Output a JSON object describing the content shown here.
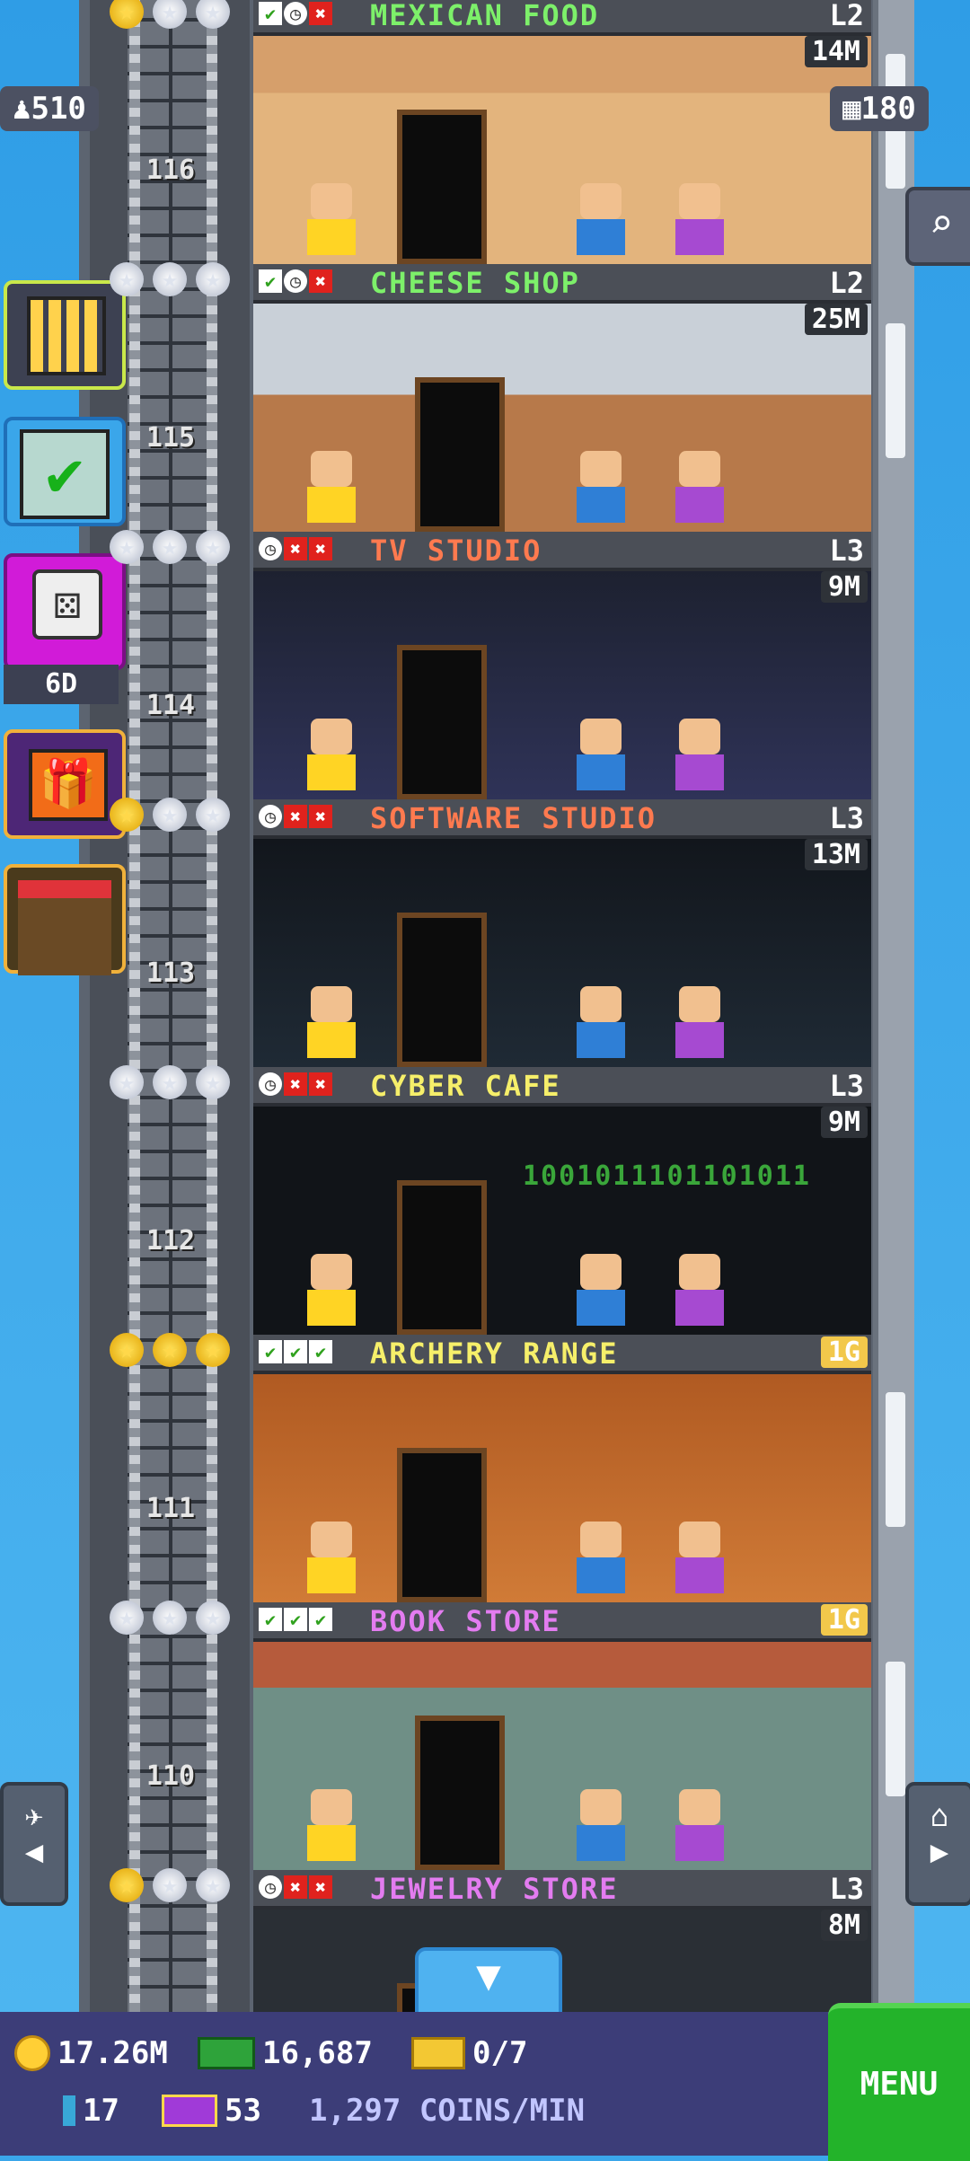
{
  "top": {
    "population": "510",
    "bux": "180"
  },
  "floors": [
    {
      "number": "116",
      "name": "MEXICAN FOOD",
      "level": "L2",
      "value": "14M",
      "status": [
        "ok",
        "clk",
        "x"
      ],
      "name_color": "#7df06a"
    },
    {
      "number": "115",
      "name": "CHEESE SHOP",
      "level": "L2",
      "value": "25M",
      "status": [
        "ok",
        "clk",
        "x"
      ],
      "name_color": "#7df06a"
    },
    {
      "number": "114",
      "name": "TV STUDIO",
      "level": "L3",
      "value": "9M",
      "status": [
        "clk",
        "x",
        "x"
      ],
      "name_color": "#ff7a4f"
    },
    {
      "number": "113",
      "name": "SOFTWARE STUDIO",
      "level": "L3",
      "value": "13M",
      "status": [
        "clk",
        "x",
        "x"
      ],
      "name_color": "#ff7a4f"
    },
    {
      "number": "112",
      "name": "CYBER CAFE",
      "level": "L3",
      "value": "9M",
      "status": [
        "clk",
        "x",
        "x"
      ],
      "name_color": "#f6ef6a"
    },
    {
      "number": "111",
      "name": "ARCHERY RANGE",
      "level": "",
      "value": "1G",
      "status": [
        "ok",
        "ok",
        "ok"
      ],
      "name_color": "#f6ef6a"
    },
    {
      "number": "110",
      "name": "BOOK STORE",
      "level": "",
      "value": "1G",
      "status": [
        "ok",
        "ok",
        "ok"
      ],
      "name_color": "#e37cf0"
    },
    {
      "number": "",
      "name": "JEWELRY STORE",
      "level": "L3",
      "value": "8M",
      "status": [
        "clk",
        "x",
        "x"
      ],
      "name_color": "#e37cf0"
    }
  ],
  "floor_stars": [
    [
      "g",
      "s",
      "s"
    ],
    [
      "s",
      "s",
      "s"
    ],
    [
      "s",
      "s",
      "s"
    ],
    [
      "g",
      "s",
      "s"
    ],
    [
      "s",
      "s",
      "s"
    ],
    [
      "g",
      "g",
      "g"
    ],
    [
      "s",
      "s",
      "s"
    ],
    [
      "g",
      "s",
      "s"
    ]
  ],
  "side": {
    "dice_label": "6D"
  },
  "cyber_binary": "1001011101101011",
  "bottom": {
    "coins": "17.26M",
    "bux": "16,687",
    "tickets": "0/7",
    "keys": "17",
    "vip": "53",
    "rate": "1,297 COINS/MIN",
    "menu": "MENU"
  },
  "colors": {
    "sky": "#3aa6ea",
    "menu": "#23b32a",
    "bottom_bar": "#3c3d78"
  },
  "icons": [
    "person-icon",
    "building-icon",
    "search-icon",
    "tasks-icon",
    "dice-icon",
    "gift-icon",
    "market-icon",
    "coin-icon",
    "bux-icon",
    "ticket-icon",
    "key-icon",
    "vip-icon",
    "elevator-icon",
    "home-icon",
    "down-arrow-icon"
  ]
}
